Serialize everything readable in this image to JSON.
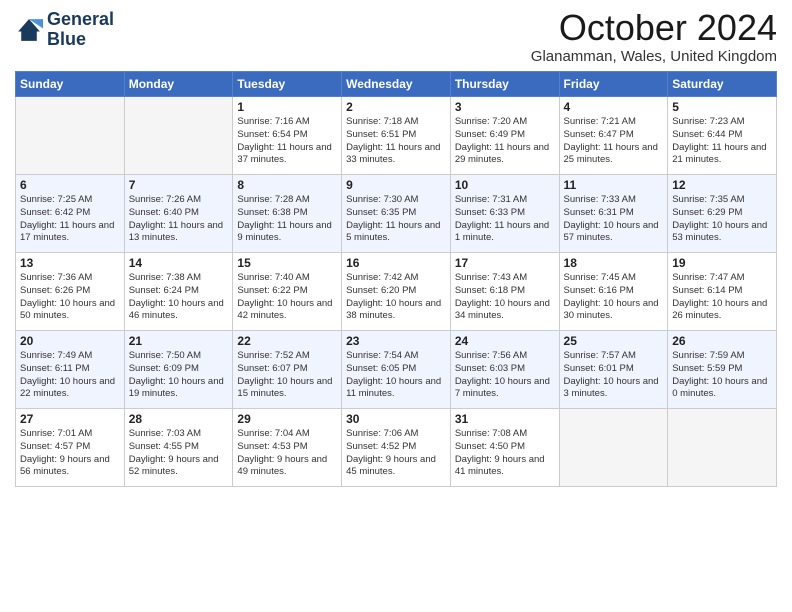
{
  "logo": {
    "line1": "General",
    "line2": "Blue"
  },
  "title": "October 2024",
  "location": "Glanamman, Wales, United Kingdom",
  "days_of_week": [
    "Sunday",
    "Monday",
    "Tuesday",
    "Wednesday",
    "Thursday",
    "Friday",
    "Saturday"
  ],
  "weeks": [
    [
      {
        "day": "",
        "info": ""
      },
      {
        "day": "",
        "info": ""
      },
      {
        "day": "1",
        "info": "Sunrise: 7:16 AM\nSunset: 6:54 PM\nDaylight: 11 hours and 37 minutes."
      },
      {
        "day": "2",
        "info": "Sunrise: 7:18 AM\nSunset: 6:51 PM\nDaylight: 11 hours and 33 minutes."
      },
      {
        "day": "3",
        "info": "Sunrise: 7:20 AM\nSunset: 6:49 PM\nDaylight: 11 hours and 29 minutes."
      },
      {
        "day": "4",
        "info": "Sunrise: 7:21 AM\nSunset: 6:47 PM\nDaylight: 11 hours and 25 minutes."
      },
      {
        "day": "5",
        "info": "Sunrise: 7:23 AM\nSunset: 6:44 PM\nDaylight: 11 hours and 21 minutes."
      }
    ],
    [
      {
        "day": "6",
        "info": "Sunrise: 7:25 AM\nSunset: 6:42 PM\nDaylight: 11 hours and 17 minutes."
      },
      {
        "day": "7",
        "info": "Sunrise: 7:26 AM\nSunset: 6:40 PM\nDaylight: 11 hours and 13 minutes."
      },
      {
        "day": "8",
        "info": "Sunrise: 7:28 AM\nSunset: 6:38 PM\nDaylight: 11 hours and 9 minutes."
      },
      {
        "day": "9",
        "info": "Sunrise: 7:30 AM\nSunset: 6:35 PM\nDaylight: 11 hours and 5 minutes."
      },
      {
        "day": "10",
        "info": "Sunrise: 7:31 AM\nSunset: 6:33 PM\nDaylight: 11 hours and 1 minute."
      },
      {
        "day": "11",
        "info": "Sunrise: 7:33 AM\nSunset: 6:31 PM\nDaylight: 10 hours and 57 minutes."
      },
      {
        "day": "12",
        "info": "Sunrise: 7:35 AM\nSunset: 6:29 PM\nDaylight: 10 hours and 53 minutes."
      }
    ],
    [
      {
        "day": "13",
        "info": "Sunrise: 7:36 AM\nSunset: 6:26 PM\nDaylight: 10 hours and 50 minutes."
      },
      {
        "day": "14",
        "info": "Sunrise: 7:38 AM\nSunset: 6:24 PM\nDaylight: 10 hours and 46 minutes."
      },
      {
        "day": "15",
        "info": "Sunrise: 7:40 AM\nSunset: 6:22 PM\nDaylight: 10 hours and 42 minutes."
      },
      {
        "day": "16",
        "info": "Sunrise: 7:42 AM\nSunset: 6:20 PM\nDaylight: 10 hours and 38 minutes."
      },
      {
        "day": "17",
        "info": "Sunrise: 7:43 AM\nSunset: 6:18 PM\nDaylight: 10 hours and 34 minutes."
      },
      {
        "day": "18",
        "info": "Sunrise: 7:45 AM\nSunset: 6:16 PM\nDaylight: 10 hours and 30 minutes."
      },
      {
        "day": "19",
        "info": "Sunrise: 7:47 AM\nSunset: 6:14 PM\nDaylight: 10 hours and 26 minutes."
      }
    ],
    [
      {
        "day": "20",
        "info": "Sunrise: 7:49 AM\nSunset: 6:11 PM\nDaylight: 10 hours and 22 minutes."
      },
      {
        "day": "21",
        "info": "Sunrise: 7:50 AM\nSunset: 6:09 PM\nDaylight: 10 hours and 19 minutes."
      },
      {
        "day": "22",
        "info": "Sunrise: 7:52 AM\nSunset: 6:07 PM\nDaylight: 10 hours and 15 minutes."
      },
      {
        "day": "23",
        "info": "Sunrise: 7:54 AM\nSunset: 6:05 PM\nDaylight: 10 hours and 11 minutes."
      },
      {
        "day": "24",
        "info": "Sunrise: 7:56 AM\nSunset: 6:03 PM\nDaylight: 10 hours and 7 minutes."
      },
      {
        "day": "25",
        "info": "Sunrise: 7:57 AM\nSunset: 6:01 PM\nDaylight: 10 hours and 3 minutes."
      },
      {
        "day": "26",
        "info": "Sunrise: 7:59 AM\nSunset: 5:59 PM\nDaylight: 10 hours and 0 minutes."
      }
    ],
    [
      {
        "day": "27",
        "info": "Sunrise: 7:01 AM\nSunset: 4:57 PM\nDaylight: 9 hours and 56 minutes."
      },
      {
        "day": "28",
        "info": "Sunrise: 7:03 AM\nSunset: 4:55 PM\nDaylight: 9 hours and 52 minutes."
      },
      {
        "day": "29",
        "info": "Sunrise: 7:04 AM\nSunset: 4:53 PM\nDaylight: 9 hours and 49 minutes."
      },
      {
        "day": "30",
        "info": "Sunrise: 7:06 AM\nSunset: 4:52 PM\nDaylight: 9 hours and 45 minutes."
      },
      {
        "day": "31",
        "info": "Sunrise: 7:08 AM\nSunset: 4:50 PM\nDaylight: 9 hours and 41 minutes."
      },
      {
        "day": "",
        "info": ""
      },
      {
        "day": "",
        "info": ""
      }
    ]
  ]
}
